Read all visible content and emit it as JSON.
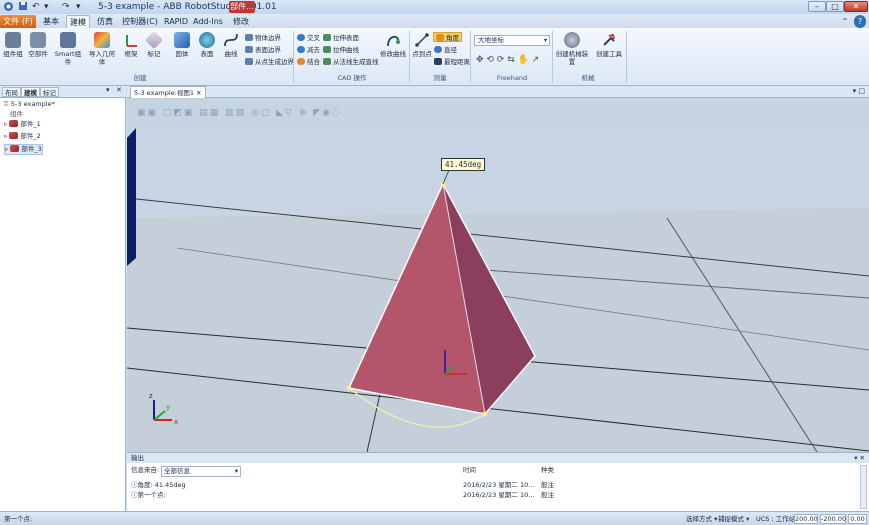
{
  "window": {
    "title": "5-3 example - ABB RobotStudio 6.01.01",
    "context_tab": "部件..."
  },
  "quick_access": {
    "undo": "↶",
    "redo": "↷",
    "menu": "▾"
  },
  "tabs": [
    "文件 (F)",
    "基本",
    "建模",
    "仿真",
    "控制器(C)",
    "RAPID",
    "Add-Ins",
    "修改"
  ],
  "active_tab_index": 2,
  "ribbon": {
    "create": {
      "buttons": [
        "组件组",
        "空部件",
        "Smart组件",
        "导入几何体",
        "框架",
        "标记"
      ],
      "group_label": "创建"
    },
    "shapes": {
      "buttons": [
        "固体",
        "表面",
        "曲线"
      ]
    },
    "border": {
      "items": [
        "物体边界",
        "表面边界",
        "从点生成边界"
      ]
    },
    "cad": {
      "items": [
        "交叉",
        "减去",
        "结合",
        "拉伸表面",
        "拉伸曲线",
        "从法线生成直线"
      ],
      "modify_curve": "修改曲线",
      "group_label": "CAD 操作"
    },
    "measure": {
      "point_to_point": "点到点",
      "items": [
        "角度",
        "直径",
        "最短距离"
      ],
      "group_label": "测量"
    },
    "freehand": {
      "coord_system": "大地坐标",
      "group_label": "Freehand"
    },
    "mechanism": {
      "buttons": [
        "创建机械装置",
        "创建工具"
      ],
      "group_label": "机械"
    },
    "help_icon": "?"
  },
  "left_panel": {
    "tabs": [
      "布局",
      "建模",
      "标记"
    ],
    "active_tab_index": 1,
    "root": "5-3 example*",
    "group": "组件",
    "parts": [
      "部件_1",
      "部件_2",
      "部件_3"
    ],
    "selected_part_index": 2
  },
  "view": {
    "tab_label": "5-3 example:视图1",
    "measure_label": "41.45deg"
  },
  "output": {
    "title": "输出",
    "filter_label": "信息来自:",
    "filter_value": "全部信息",
    "columns": {
      "time": "时间",
      "category": "种类"
    },
    "rows": [
      {
        "text": "角度: 41.45deg",
        "time": "2016/2/23 星期二 10...",
        "category": "般注"
      },
      {
        "text": "第一个点:",
        "time": "2016/2/23 星期二 10...",
        "category": "般注"
      }
    ]
  },
  "status": {
    "left": "第一个点:",
    "select_mode": "选择方式 ▾",
    "snap_mode": "捕捉模式 ▾",
    "ucs": "UCS : 工作站",
    "coords": [
      "200.00",
      "-200.00",
      "0.00"
    ]
  },
  "colors": {
    "pyramid_light": "#b3566c",
    "pyramid_dark": "#8b3f5c",
    "ribbon_file": "#e07a2a",
    "context_tab": "#c03535"
  }
}
